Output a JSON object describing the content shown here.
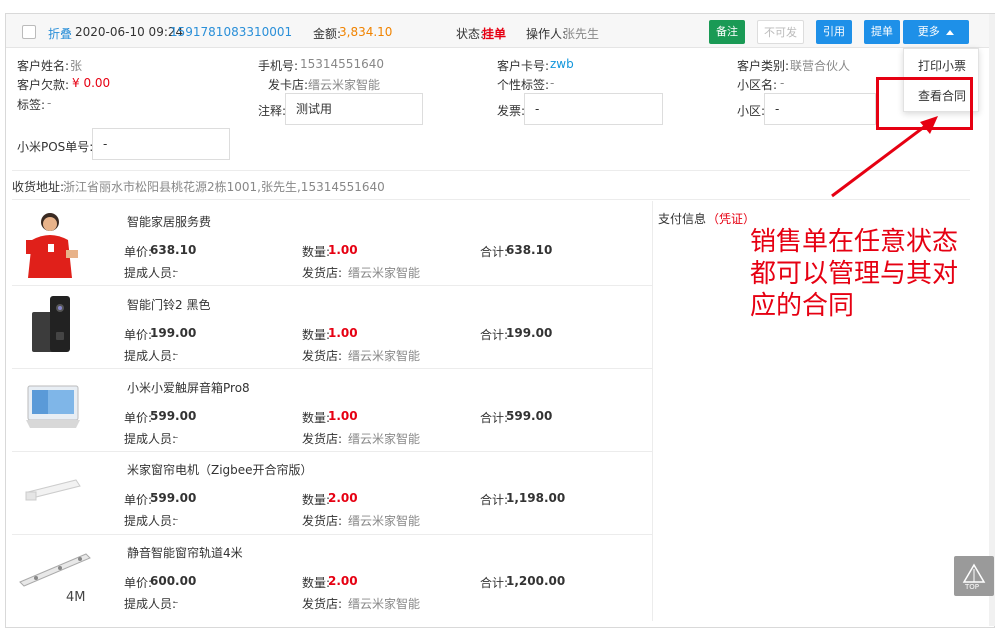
{
  "header": {
    "fold_label": "折叠",
    "datetime": "2020-06-10 09:24",
    "order_no": "1591781083310001",
    "amount_label": "金额:",
    "amount_value": "3,834.10",
    "status_label": "状态:",
    "status_value": "挂单",
    "operator_label": "操作人:",
    "operator_value": "张先生",
    "buttons": {
      "note": "备注",
      "unshippable": "不可发",
      "quote": "引用",
      "pickup": "提单",
      "more": "更多"
    }
  },
  "dropdown": {
    "print_receipt": "打印小票",
    "view_contract": "查看合同"
  },
  "customer": {
    "name_label": "客户姓名:",
    "name_value": "张",
    "phone_label": "手机号:",
    "phone_value": "15314551640",
    "card_label": "客户卡号:",
    "card_value": "zwb",
    "category_label": "客户类别:",
    "category_value": "联营合伙人",
    "debt_label": "客户欠款:",
    "debt_value": "¥ 0.00",
    "issuer_label": "发卡店:",
    "issuer_value": "缙云米家智能",
    "personal_tag_label": "个性标签:",
    "personal_tag_value": "-",
    "community_name_label": "小区名:",
    "community_name_value": "-",
    "tag_label": "标签:",
    "tag_value": "-",
    "remark_label": "注释:",
    "remark_value": "测试用",
    "invoice_label": "发票:",
    "invoice_value": "-",
    "community_label": "小区:",
    "community_value": "-",
    "pos_label": "小米POS单号:",
    "pos_value": "-",
    "address_label": "收货地址:",
    "address_value": "浙江省丽水市松阳县桃花源2栋1001,张先生,15314551640"
  },
  "payment": {
    "label": "支付信息",
    "voucher": "凭证"
  },
  "labels": {
    "unit_price": "单价:",
    "quantity": "数量:",
    "total": "合计:",
    "commission": "提成人员:",
    "ship_store": "发货店:"
  },
  "items": [
    {
      "name": "智能家居服务费",
      "price": "638.10",
      "qty": "1.00",
      "total": "638.10",
      "commission": "-",
      "store": "缙云米家智能",
      "icon": "person-in-red-icon"
    },
    {
      "name": "智能门铃2 黑色",
      "price": "199.00",
      "qty": "1.00",
      "total": "199.00",
      "commission": "-",
      "store": "缙云米家智能",
      "icon": "doorbell-icon"
    },
    {
      "name": "小米小爱触屏音箱Pro8",
      "price": "599.00",
      "qty": "1.00",
      "total": "599.00",
      "commission": "-",
      "store": "缙云米家智能",
      "icon": "smart-display-icon"
    },
    {
      "name": "米家窗帘电机（Zigbee开合帘版）",
      "price": "599.00",
      "qty": "2.00",
      "total": "1,198.00",
      "commission": "-",
      "store": "缙云米家智能",
      "icon": "curtain-motor-icon"
    },
    {
      "name": "静音智能窗帘轨道4米",
      "price": "600.00",
      "qty": "2.00",
      "total": "1,200.00",
      "commission": "-",
      "store": "缙云米家智能",
      "icon": "curtain-rail-icon",
      "thumb_caption": "4M"
    }
  ],
  "annotation": {
    "text": "销售单在任意状态都可以管理与其对应的合同",
    "color": "#e60012"
  },
  "top_button": "TOP"
}
